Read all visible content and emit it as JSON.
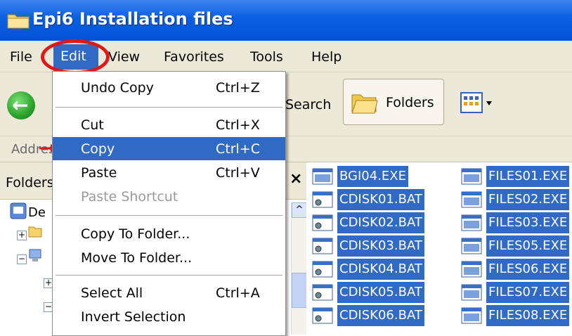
{
  "window": {
    "title": "Epi6 Installation files"
  },
  "menubar": {
    "items": [
      "File",
      "Edit",
      "View",
      "Favorites",
      "Tools",
      "Help"
    ]
  },
  "toolbar": {
    "search_label": "Search",
    "folders_label": "Folders"
  },
  "addressbar": {
    "label": "Address"
  },
  "folders_pane": {
    "title": "Folders",
    "tree_desktop_label": "De"
  },
  "edit_menu": {
    "items": [
      {
        "label": "Undo Copy",
        "shortcut": "Ctrl+Z"
      },
      {
        "label": "Cut",
        "shortcut": "Ctrl+X"
      },
      {
        "label": "Copy",
        "shortcut": "Ctrl+C"
      },
      {
        "label": "Paste",
        "shortcut": "Ctrl+V"
      },
      {
        "label": "Paste Shortcut",
        "shortcut": ""
      },
      {
        "label": "Copy To Folder...",
        "shortcut": ""
      },
      {
        "label": "Move To Folder...",
        "shortcut": ""
      },
      {
        "label": "Select All",
        "shortcut": "Ctrl+A"
      },
      {
        "label": "Invert Selection",
        "shortcut": ""
      }
    ]
  },
  "files": {
    "col1": [
      "BGI04.EXE",
      "CDISK01.BAT",
      "CDISK02.BAT",
      "CDISK03.BAT",
      "CDISK04.BAT",
      "CDISK05.BAT",
      "CDISK06.BAT"
    ],
    "col2": [
      "FILES01.EXE",
      "FILES02.EXE",
      "FILES03.EXE",
      "FILES05.EXE",
      "FILES06.EXE",
      "FILES07.EXE",
      "FILES08.EXE"
    ]
  },
  "colors": {
    "selection": "#316ac5",
    "titlebar": "#0a5fe0",
    "annotation": "#e01818"
  },
  "icons": [
    "folder-icon",
    "back-arrow-icon",
    "folders-icon",
    "views-icon",
    "batch-file-icon",
    "exe-file-icon",
    "desktop-icon"
  ]
}
